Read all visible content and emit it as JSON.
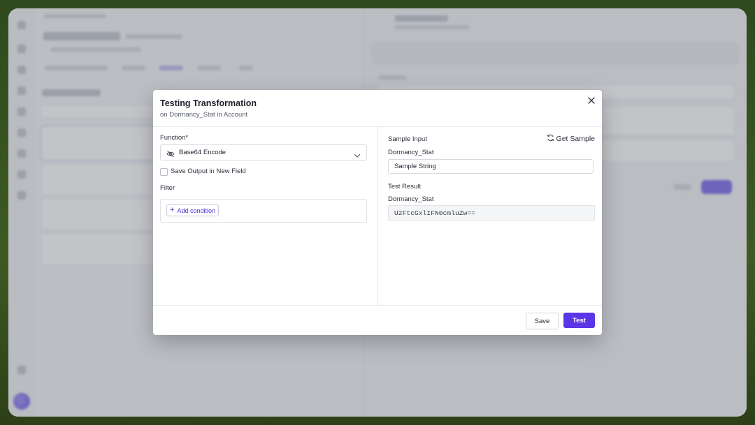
{
  "modal": {
    "title": "Testing Transformation",
    "subtitle": "on Dormancy_Stat in Account",
    "close_icon": "close-icon"
  },
  "left": {
    "function_label": "Function*",
    "function_value": "Base64 Encode",
    "function_icon": "eye-off-icon",
    "save_output_label": "Save Output in New Field",
    "save_output_checked": false,
    "filter_label": "Filter",
    "add_condition_label": "Add condition"
  },
  "right": {
    "sample_input_label": "Sample Input",
    "get_sample_label": "Get Sample",
    "input_field_label": "Dormancy_Stat",
    "input_value": "Sample String",
    "test_result_label": "Test Result",
    "result_field_label": "Dormancy_Stat",
    "result_value": "U2FtcGxlIFN0cmluZw=="
  },
  "footer": {
    "save_label": "Save",
    "test_label": "Test"
  },
  "colors": {
    "accent": "#5b36e6",
    "link": "#4a2fd1"
  }
}
